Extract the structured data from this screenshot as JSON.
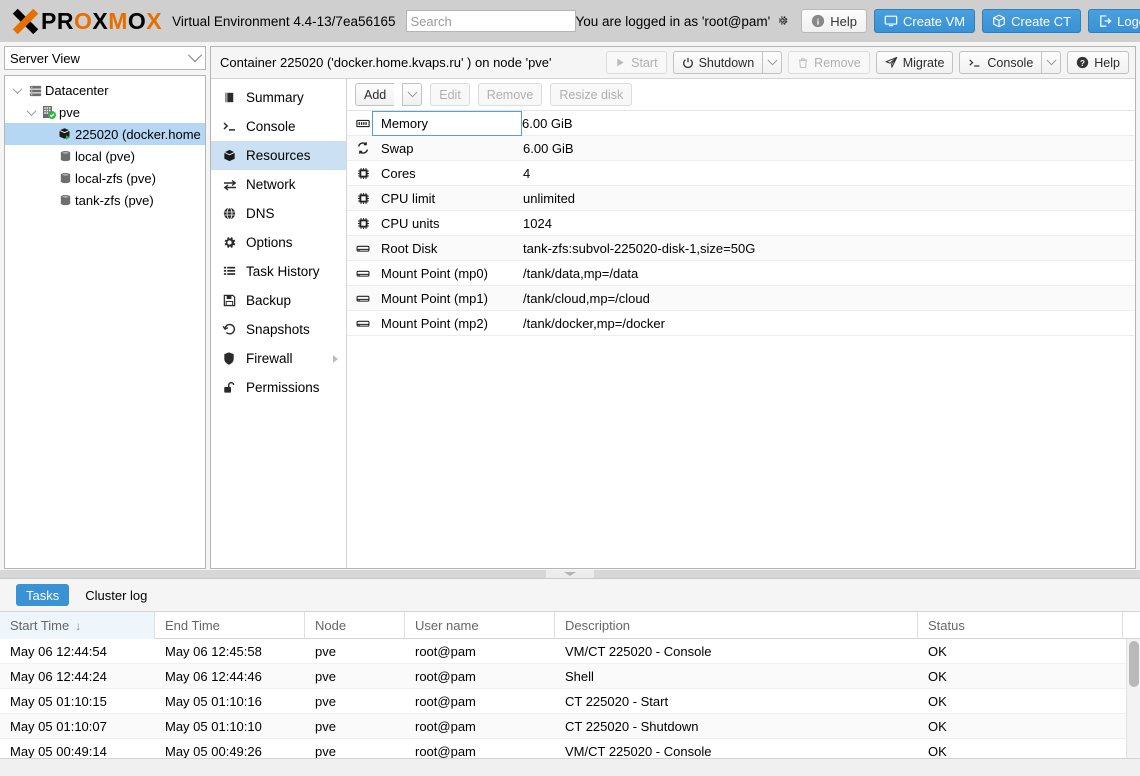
{
  "header": {
    "brand": "PROXMOX",
    "product": "Virtual Environment 4.4-13/7ea56165",
    "search": {
      "placeholder": "Search",
      "value": ""
    },
    "login_text": "You are logged in as 'root@pam'",
    "settings_icon": "gear-icon",
    "buttons": [
      {
        "label": "Help",
        "icon": "info-icon",
        "style": "light"
      },
      {
        "label": "Create VM",
        "icon": "monitor-icon",
        "style": "blue"
      },
      {
        "label": "Create CT",
        "icon": "cube-icon",
        "style": "blue"
      },
      {
        "label": "Logout",
        "icon": "logout-icon",
        "style": "blue"
      }
    ]
  },
  "sidebar": {
    "view_selector": {
      "label": "Server View",
      "icon": "chevron-down-icon"
    },
    "tree": [
      {
        "label": "Datacenter",
        "icon": "datacenter-icon",
        "indent": 0,
        "expander": true,
        "selected": false
      },
      {
        "label": "pve",
        "icon": "node-icon",
        "indent": 1,
        "expander": true,
        "selected": false,
        "badge": "online-check"
      },
      {
        "label": "225020 (docker.home",
        "icon": "container-icon",
        "indent": 2,
        "expander": false,
        "selected": true,
        "badge": "running-play"
      },
      {
        "label": "local (pve)",
        "icon": "storage-icon",
        "indent": 2,
        "expander": false,
        "selected": false
      },
      {
        "label": "local-zfs (pve)",
        "icon": "storage-icon",
        "indent": 2,
        "expander": false,
        "selected": false
      },
      {
        "label": "tank-zfs (pve)",
        "icon": "storage-icon",
        "indent": 2,
        "expander": false,
        "selected": false
      }
    ]
  },
  "content": {
    "title": "Container 225020 ('docker.home.kvaps.ru' ) on node 'pve'",
    "actions": [
      {
        "label": "Start",
        "icon": "play-icon",
        "disabled": true,
        "split": false
      },
      {
        "label": "Shutdown",
        "icon": "power-icon",
        "disabled": false,
        "split": true
      },
      {
        "label": "Remove",
        "icon": "trash-icon",
        "disabled": true,
        "split": false
      },
      {
        "label": "Migrate",
        "icon": "migrate-icon",
        "disabled": false,
        "split": false
      },
      {
        "label": "Console",
        "icon": "terminal-icon",
        "disabled": false,
        "split": true
      },
      {
        "label": "Help",
        "icon": "help-icon",
        "disabled": false,
        "split": false
      }
    ],
    "menu": [
      {
        "label": "Summary",
        "icon": "book-icon",
        "selected": false,
        "submenu": false
      },
      {
        "label": "Console",
        "icon": "terminal-icon",
        "selected": false,
        "submenu": false
      },
      {
        "label": "Resources",
        "icon": "cube-icon",
        "selected": true,
        "submenu": false
      },
      {
        "label": "Network",
        "icon": "network-icon",
        "selected": false,
        "submenu": false
      },
      {
        "label": "DNS",
        "icon": "globe-icon",
        "selected": false,
        "submenu": false
      },
      {
        "label": "Options",
        "icon": "gear-icon",
        "selected": false,
        "submenu": false
      },
      {
        "label": "Task History",
        "icon": "list-icon",
        "selected": false,
        "submenu": false
      },
      {
        "label": "Backup",
        "icon": "floppy-icon",
        "selected": false,
        "submenu": false
      },
      {
        "label": "Snapshots",
        "icon": "history-icon",
        "selected": false,
        "submenu": false
      },
      {
        "label": "Firewall",
        "icon": "shield-icon",
        "selected": false,
        "submenu": true
      },
      {
        "label": "Permissions",
        "icon": "unlock-icon",
        "selected": false,
        "submenu": false
      }
    ],
    "grid_toolbar": [
      {
        "label": "Add",
        "disabled": false,
        "split": true
      },
      {
        "label": "Edit",
        "disabled": true,
        "split": false
      },
      {
        "label": "Remove",
        "disabled": true,
        "split": false
      },
      {
        "label": "Resize disk",
        "disabled": true,
        "split": false
      }
    ],
    "resources": [
      {
        "icon": "memory-icon",
        "key": "Memory",
        "value": "6.00 GiB",
        "focused": true
      },
      {
        "icon": "swap-icon",
        "key": "Swap",
        "value": "6.00 GiB",
        "focused": false
      },
      {
        "icon": "cpu-icon",
        "key": "Cores",
        "value": "4",
        "focused": false
      },
      {
        "icon": "cpu-icon",
        "key": "CPU limit",
        "value": "unlimited",
        "focused": false
      },
      {
        "icon": "cpu-icon",
        "key": "CPU units",
        "value": "1024",
        "focused": false
      },
      {
        "icon": "disk-icon",
        "key": "Root Disk",
        "value": "tank-zfs:subvol-225020-disk-1,size=50G",
        "focused": false
      },
      {
        "icon": "disk-icon",
        "key": "Mount Point (mp0)",
        "value": "/tank/data,mp=/data",
        "focused": false
      },
      {
        "icon": "disk-icon",
        "key": "Mount Point (mp1)",
        "value": "/tank/cloud,mp=/cloud",
        "focused": false
      },
      {
        "icon": "disk-icon",
        "key": "Mount Point (mp2)",
        "value": "/tank/docker,mp=/docker",
        "focused": false
      }
    ]
  },
  "tasks_panel": {
    "tabs": [
      {
        "label": "Tasks",
        "active": true
      },
      {
        "label": "Cluster log",
        "active": false
      }
    ],
    "columns": [
      {
        "label": "Start Time",
        "sorted": true,
        "sort_arrow": "↓"
      },
      {
        "label": "End Time",
        "sorted": false,
        "sort_arrow": ""
      },
      {
        "label": "Node",
        "sorted": false,
        "sort_arrow": ""
      },
      {
        "label": "User name",
        "sorted": false,
        "sort_arrow": ""
      },
      {
        "label": "Description",
        "sorted": false,
        "sort_arrow": ""
      },
      {
        "label": "Status",
        "sorted": false,
        "sort_arrow": ""
      }
    ],
    "rows": [
      {
        "start": "May 06 12:44:54",
        "end": "May 06 12:45:58",
        "node": "pve",
        "user": "root@pam",
        "description": "VM/CT 225020 - Console",
        "status": "OK"
      },
      {
        "start": "May 06 12:44:24",
        "end": "May 06 12:44:46",
        "node": "pve",
        "user": "root@pam",
        "description": "Shell",
        "status": "OK"
      },
      {
        "start": "May 05 01:10:15",
        "end": "May 05 01:10:16",
        "node": "pve",
        "user": "root@pam",
        "description": "CT 225020 - Start",
        "status": "OK"
      },
      {
        "start": "May 05 01:10:07",
        "end": "May 05 01:10:10",
        "node": "pve",
        "user": "root@pam",
        "description": "CT 225020 - Shutdown",
        "status": "OK"
      },
      {
        "start": "May 05 00:49:14",
        "end": "May 05 00:49:26",
        "node": "pve",
        "user": "root@pam",
        "description": "VM/CT 225020 - Console",
        "status": "OK"
      }
    ]
  },
  "colors": {
    "accent_blue": "#3892d4",
    "brand_orange": "#e57000",
    "selection_blue": "#cbe0f2",
    "tree_selection": "#b6d7f4",
    "header_grey": "#cfcfcf"
  }
}
